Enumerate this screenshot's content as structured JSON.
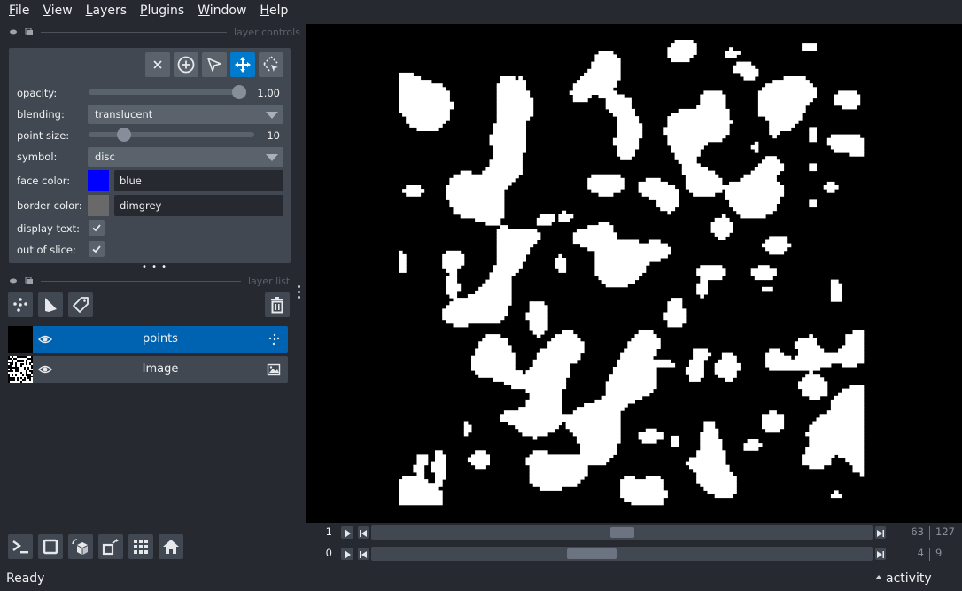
{
  "menubar": {
    "items": [
      {
        "label_ul": "F",
        "label_rest": "ile"
      },
      {
        "label_ul": "V",
        "label_rest": "iew"
      },
      {
        "label_ul": "L",
        "label_rest": "ayers"
      },
      {
        "label_ul": "P",
        "label_rest": "lugins"
      },
      {
        "label_ul": "W",
        "label_rest": "indow"
      },
      {
        "label_ul": "H",
        "label_rest": "elp"
      }
    ]
  },
  "layer_controls": {
    "title": "layer controls",
    "tools": [
      {
        "name": "delete-selected-points",
        "icon": "close-icon"
      },
      {
        "name": "add-points",
        "icon": "add-circle-icon"
      },
      {
        "name": "select-points",
        "icon": "select-arrow-icon"
      },
      {
        "name": "pan-zoom",
        "icon": "move-arrows-icon",
        "active": true
      },
      {
        "name": "transform",
        "icon": "transform-icon"
      }
    ],
    "opacity": {
      "label": "opacity:",
      "value": 1.0,
      "display": "1.00"
    },
    "blending": {
      "label": "blending:",
      "value": "translucent"
    },
    "point_size": {
      "label": "point size:",
      "value": 10,
      "display": "10",
      "min": 1,
      "max": 100
    },
    "symbol": {
      "label": "symbol:",
      "value": "disc"
    },
    "face_color": {
      "label": "face color:",
      "value": "blue",
      "swatch": "#0000ff"
    },
    "border_color": {
      "label": "border color:",
      "value": "dimgrey",
      "swatch": "#696969"
    },
    "display_text": {
      "label": "display text:",
      "checked": true
    },
    "out_of_slice": {
      "label": "out of slice:",
      "checked": true
    }
  },
  "layer_list": {
    "title": "layer list",
    "layers": [
      {
        "name": "points",
        "type": "points",
        "visible": true,
        "selected": true
      },
      {
        "name": "Image",
        "type": "image",
        "visible": true,
        "selected": false
      }
    ]
  },
  "dims": [
    {
      "axis": "1",
      "current": "63",
      "max": "127",
      "fraction": 0.5
    },
    {
      "axis": "0",
      "current": "4",
      "max": "9",
      "fraction": 0.44
    }
  ],
  "status": {
    "text": "Ready",
    "activity": "activity"
  },
  "colors": {
    "accent": "#007acc",
    "selected_layer": "#0063b1",
    "background": "#262930",
    "panel": "#414851"
  }
}
